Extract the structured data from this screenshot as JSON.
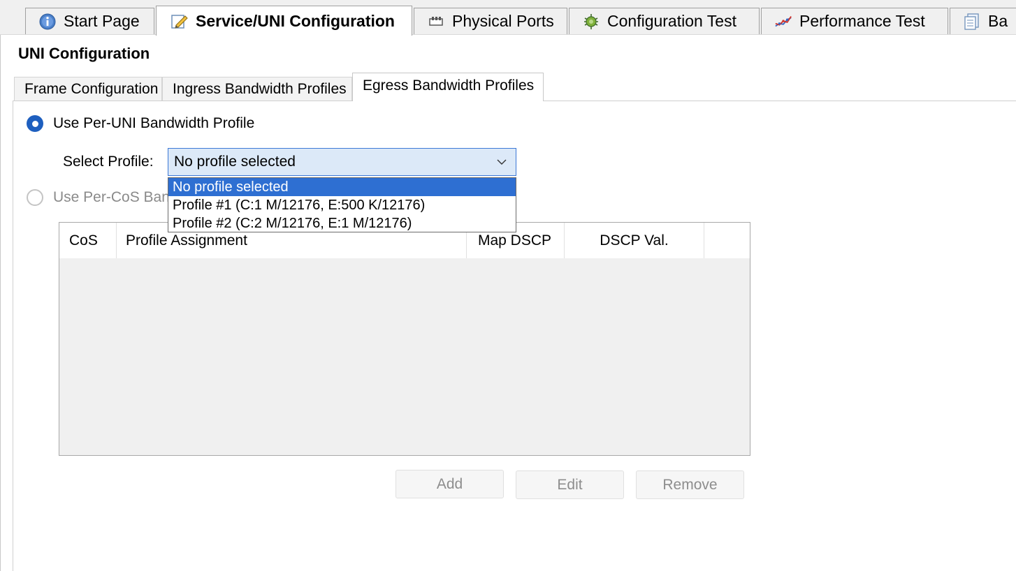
{
  "top_tabs": [
    {
      "label": "Start Page",
      "icon": "info-icon",
      "active": false
    },
    {
      "label": "Service/UNI Configuration",
      "icon": "pencil-icon",
      "active": true
    },
    {
      "label": "Physical Ports",
      "icon": "ports-icon",
      "active": false
    },
    {
      "label": "Configuration Test",
      "icon": "bug-icon",
      "active": false
    },
    {
      "label": "Performance Test",
      "icon": "line-chart-icon",
      "active": false
    },
    {
      "label": "Ba",
      "icon": "report-icon",
      "active": false
    }
  ],
  "section_title": "UNI Configuration",
  "sub_tabs": [
    {
      "label": "Frame Configuration",
      "active": false
    },
    {
      "label": "Ingress Bandwidth Profiles",
      "active": false
    },
    {
      "label": "Egress Bandwidth Profiles",
      "active": true
    }
  ],
  "option_per_uni": {
    "label": "Use Per-UNI Bandwidth Profile",
    "selected": true
  },
  "option_per_cos": {
    "label": "Use Per-CoS Ban",
    "selected": false,
    "enabled": false
  },
  "select_profile": {
    "label": "Select Profile:",
    "value": "No profile selected",
    "options": [
      "No profile selected",
      "Profile #1 (C:1 M/12176, E:500 K/12176)",
      "Profile #2 (C:2 M/12176, E:1 M/12176)"
    ],
    "highlighted_index": 0
  },
  "table": {
    "columns": [
      "CoS",
      "Profile Assignment",
      "Map DSCP",
      "DSCP Val."
    ],
    "rows": []
  },
  "buttons": {
    "add": "Add",
    "edit": "Edit",
    "remove": "Remove"
  },
  "colors": {
    "accent": "#2e6fd2",
    "select_bg": "#dce9f8"
  }
}
